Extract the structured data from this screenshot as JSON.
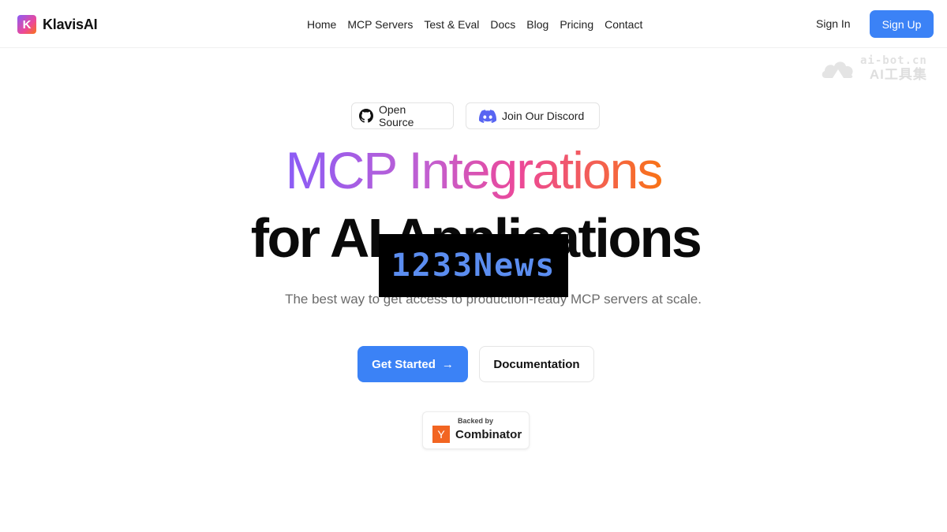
{
  "header": {
    "brand_mark": "K",
    "brand": "KlavisAI",
    "nav": [
      "Home",
      "MCP Servers",
      "Test & Eval",
      "Docs",
      "Blog",
      "Pricing",
      "Contact"
    ],
    "sign_in": "Sign In",
    "sign_up": "Sign Up"
  },
  "watermark": {
    "url": "ai-bot.cn",
    "name": "AI工具集"
  },
  "chips": {
    "github": "Open Source",
    "discord": "Join Our Discord"
  },
  "hero": {
    "line1": "MCP Integrations",
    "line2": "for AI Applications",
    "subtitle": "The best way to get access to production-ready MCP servers at scale."
  },
  "overlay": {
    "text": "1233News"
  },
  "cta": {
    "primary": "Get Started",
    "primary_arrow": "→",
    "secondary": "Documentation"
  },
  "yc": {
    "backed_by": "Backed by",
    "logo": "Y",
    "name": "Combinator"
  },
  "colors": {
    "accent": "#3b82f6",
    "gradient_start": "#8b5cf6",
    "gradient_end": "#f97316",
    "yc_orange": "#f26522",
    "discord": "#5865f2"
  }
}
